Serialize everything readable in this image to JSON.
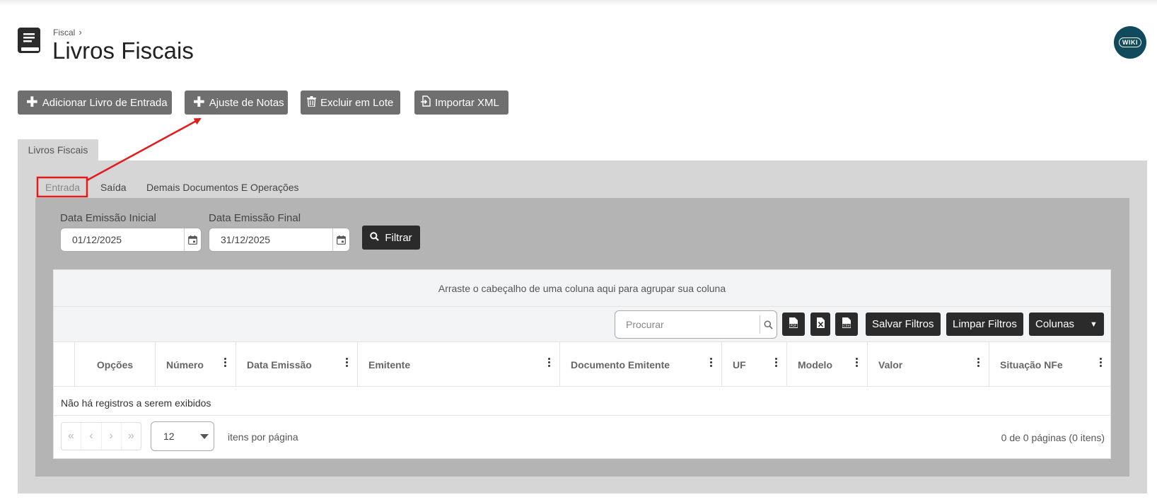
{
  "header": {
    "breadcrumb": "Fiscal",
    "breadcrumb_separator": "›",
    "title": "Livros Fiscais",
    "wiki_label": "WIKI"
  },
  "toolbar": {
    "add_entry_book": "Adicionar Livro de Entrada",
    "adjust_notes": "Ajuste de Notas",
    "batch_delete": "Excluir em Lote",
    "import_xml": "Importar XML"
  },
  "outer_tab": "Livros Fiscais",
  "subtabs": {
    "entrada": "Entrada",
    "saida": "Saída",
    "demais": "Demais Documentos E Operações"
  },
  "filters": {
    "start_label": "Data Emissão Inicial",
    "start_value": "01/12/2025",
    "end_label": "Data Emissão Final",
    "end_value": "31/12/2025",
    "filter_button": "Filtrar"
  },
  "grid": {
    "group_hint": "Arraste o cabeçalho de uma coluna aqui para agrupar sua coluna",
    "search_placeholder": "Procurar",
    "save_filters": "Salvar Filtros",
    "clear_filters": "Limpar Filtros",
    "columns_button": "Colunas",
    "export_icons": [
      "pdf-icon",
      "excel-icon",
      "csv-icon"
    ],
    "columns": [
      "Opções",
      "Número",
      "Data Emissão",
      "Emitente",
      "Documento Emitente",
      "UF",
      "Modelo",
      "Valor",
      "Situação NFe"
    ],
    "empty_message": "Não há registros a serem exibidos",
    "page_size": "12",
    "items_per_page": "itens por página",
    "page_info": "0 de 0 páginas (0 itens)"
  },
  "colors": {
    "toolbar_button": "#6f6f6f",
    "dark_button": "#2b2b2b",
    "annotation": "#e31b1b",
    "wiki_badge": "#0f4b5c"
  }
}
